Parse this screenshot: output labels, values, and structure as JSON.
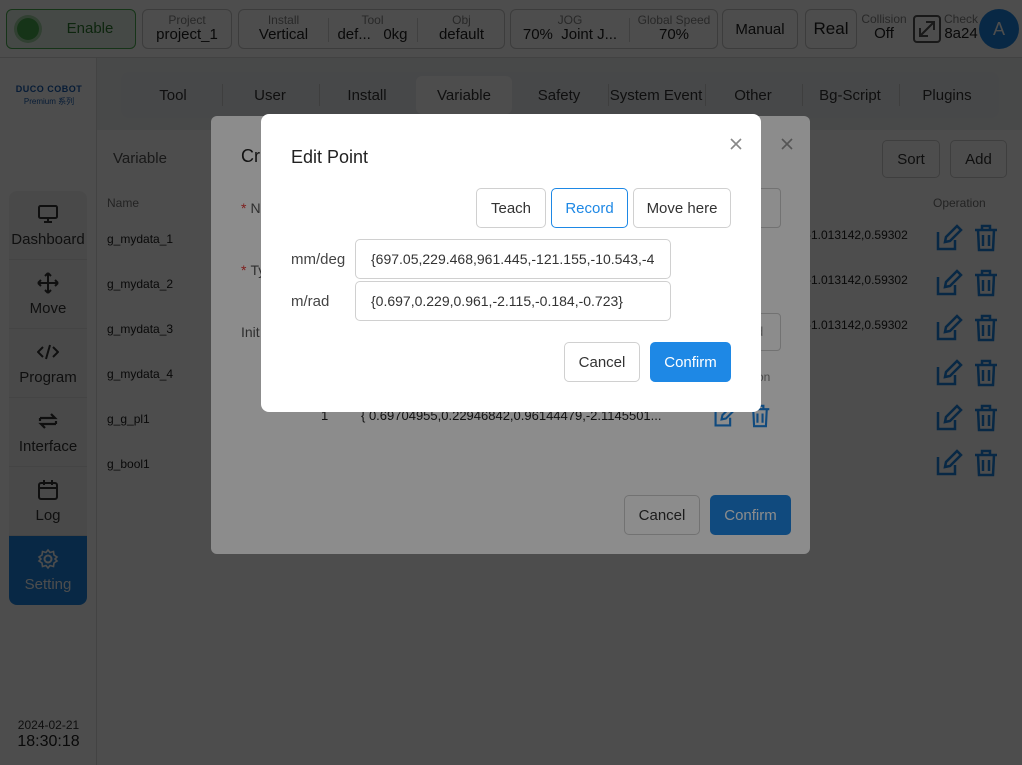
{
  "topbar": {
    "enable": "Enable",
    "project": {
      "label": "Project",
      "value": "project_1"
    },
    "install": {
      "label": "Install",
      "value": "Vertical"
    },
    "tool": {
      "label": "Tool",
      "value": "def...",
      "weight": "0kg"
    },
    "obj": {
      "label": "Obj",
      "value": "default"
    },
    "jog": {
      "label": "JOG",
      "value": "70%",
      "mode": "Joint J..."
    },
    "global_speed": {
      "label": "Global Speed",
      "value": "70%"
    },
    "manual": "Manual",
    "real": "Real",
    "collision": {
      "label": "Collision",
      "value": "Off"
    },
    "check": {
      "label": "Check",
      "value": "8a24"
    },
    "avatar": "A"
  },
  "logo": {
    "line1": "DUCO COBOT",
    "line2": "Premium 系列"
  },
  "sidebar": {
    "items": [
      {
        "label": "Dashboard",
        "icon": "monitor-icon"
      },
      {
        "label": "Move",
        "icon": "move-arrows-icon"
      },
      {
        "label": "Program",
        "icon": "code-icon"
      },
      {
        "label": "Interface",
        "icon": "swap-arrows-icon"
      },
      {
        "label": "Log",
        "icon": "calendar-icon"
      },
      {
        "label": "Setting",
        "icon": "gear-icon",
        "active": true
      }
    ],
    "date": "2024-02-21",
    "time": "18:30:18"
  },
  "tabs": [
    "Tool",
    "User",
    "Install",
    "Variable",
    "Safety",
    "System Event",
    "Other",
    "Bg-Script",
    "Plugins"
  ],
  "active_tab": "Variable",
  "subheader": {
    "title": "Variable",
    "sort": "Sort",
    "add": "Add"
  },
  "table": {
    "columns": {
      "name": "Name",
      "operation": "Operation"
    },
    "rows": [
      {
        "name": "g_mydata_1",
        "value": "4,-1.013142,0.59302"
      },
      {
        "name": "g_mydata_2",
        "value": "4,-1.013142,0.59302"
      },
      {
        "name": "g_mydata_3",
        "value": "4,-1.013142,0.59302"
      },
      {
        "name": "g_mydata_4",
        "value": ""
      },
      {
        "name": "g_g_pl1",
        "value": ""
      },
      {
        "name": "g_bool1",
        "value": ""
      }
    ]
  },
  "create_dialog": {
    "title": "Cr",
    "name_label": "N",
    "type_label": "Ty",
    "init_label": "Init",
    "input_tail": "d",
    "col_tail": "on",
    "row_index": "1",
    "row_value": "{ 0.69704955,0.22946842,0.96144479,-2.1145501...",
    "cancel": "Cancel",
    "confirm": "Confirm"
  },
  "edit_dialog": {
    "title": "Edit Point",
    "teach": "Teach",
    "record": "Record",
    "move_here": "Move here",
    "mm_label": "mm/deg",
    "mm_value": "{697.05,229.468,961.445,-121.155,-10.543,-4",
    "rad_label": "m/rad",
    "rad_value": "{0.697,0.229,0.961,-2.115,-0.184,-0.723}",
    "cancel": "Cancel",
    "confirm": "Confirm"
  },
  "colors": {
    "primary": "#1e88e5",
    "enable_green": "#4caf50",
    "mask": "rgba(0,0,0,0.45)"
  }
}
